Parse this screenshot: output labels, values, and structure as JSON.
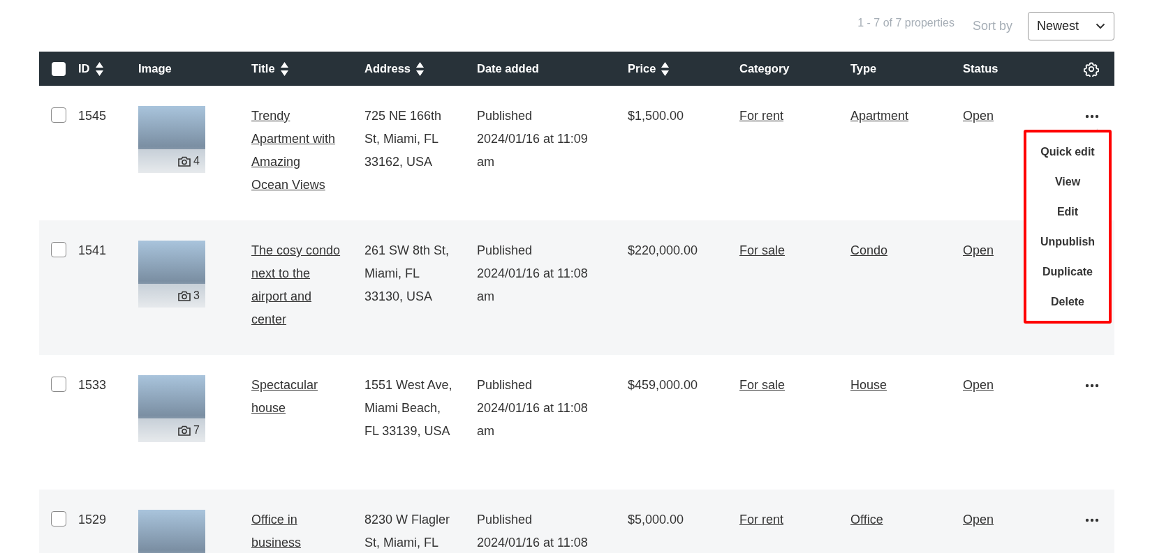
{
  "toolbar": {
    "count": "1 - 7 of 7 properties",
    "sort_label": "Sort by",
    "sort_value": "Newest"
  },
  "table": {
    "select_all": {
      "checked": false
    },
    "columns": [
      {
        "label": "ID",
        "sortable": true
      },
      {
        "label": "Image",
        "sortable": false
      },
      {
        "label": "Title",
        "sortable": true
      },
      {
        "label": "Address",
        "sortable": true
      },
      {
        "label": "Date added",
        "sortable": false
      },
      {
        "label": "Price",
        "sortable": true
      },
      {
        "label": "Category",
        "sortable": false
      },
      {
        "label": "Type",
        "sortable": false
      },
      {
        "label": "Status",
        "sortable": false
      }
    ],
    "rows": [
      {
        "checked": false,
        "id": "1545",
        "photo_count": "4",
        "title": "Trendy Apartment with Amazing Ocean Views",
        "address": "725 NE 166th St, Miami, FL 33162, USA",
        "date": "Published 2024/01/16 at 11:09 am",
        "price": "$1,500.00",
        "category": "For rent",
        "type": "Apartment",
        "status": "Open",
        "menu_open": true
      },
      {
        "checked": false,
        "id": "1541",
        "photo_count": "3",
        "title": "The cosy condo next to the airport and center",
        "address": "261 SW 8th St, Miami, FL 33130, USA",
        "date": "Published 2024/01/16 at 11:08 am",
        "price": "$220,000.00",
        "category": "For sale",
        "type": "Condo",
        "status": "Open",
        "menu_open": false
      },
      {
        "checked": false,
        "id": "1533",
        "photo_count": "7",
        "title": "Spectacular house",
        "address": "1551 West Ave, Miami Beach, FL 33139, USA",
        "date": "Published 2024/01/16 at 11:08 am",
        "price": "$459,000.00",
        "category": "For sale",
        "type": "House",
        "status": "Open",
        "menu_open": false
      },
      {
        "checked": false,
        "id": "1529",
        "title": "Office in business",
        "address": "8230 W Flagler St, Miami, FL",
        "date": "Published 2024/01/16 at 11:08",
        "price": "$5,000.00",
        "category": "For rent",
        "type": "Office",
        "status": "Open",
        "menu_open": false
      }
    ]
  },
  "action_menu": [
    "Quick edit",
    "View",
    "Edit",
    "Unpublish",
    "Duplicate",
    "Delete"
  ]
}
